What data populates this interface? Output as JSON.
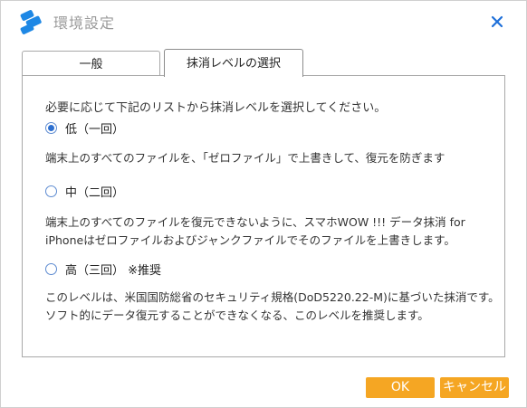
{
  "window": {
    "title": "環境設定"
  },
  "tabs": [
    {
      "label": "一般",
      "active": false
    },
    {
      "label": "抹消レベルの選択",
      "active": true
    }
  ],
  "content": {
    "intro": "必要に応じて下記のリストから抹消レベルを選択してください。",
    "options": [
      {
        "label": "低（一回）",
        "checked": true,
        "description_lines": [
          "端末上のすべてのファイルを、「ゼロファイル」で上書きして、復元を防ぎます"
        ]
      },
      {
        "label": "中（二回）",
        "checked": false,
        "description_lines": [
          "端末上のすべてのファイルを復元できないように、スマホWOW !!! データ抹消 for",
          "iPhoneはゼロファイルおよびジャンクファイルでそのファイルを上書きします。"
        ]
      },
      {
        "label": "高（三回） ※推奨",
        "checked": false,
        "description_lines": [
          "このレベルは、米国国防総省のセキュリティ規格(DoD5220.22-M)に基づいた抹消です。",
          "ソフト的にデータ復元することができなくなる、このレベルを推奨します。"
        ]
      }
    ]
  },
  "buttons": {
    "ok": "OK",
    "cancel": "キャンセル"
  },
  "colors": {
    "accent": "#f5a623",
    "radio": "#2d6fd0",
    "logo": "#1e88e5"
  },
  "icons": {
    "logo": "app-logo-icon",
    "close": "close-icon"
  }
}
